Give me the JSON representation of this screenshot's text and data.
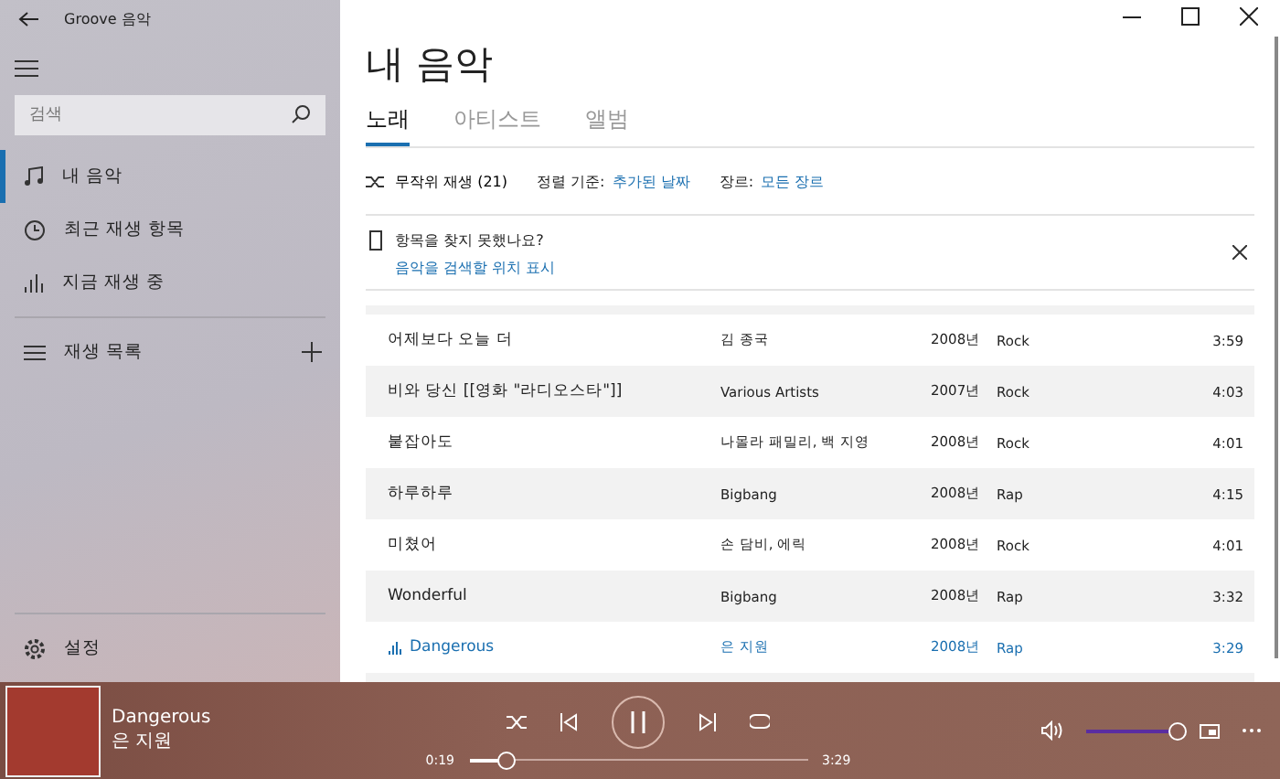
{
  "window": {
    "title": "Groove 음악"
  },
  "sidebar": {
    "search": {
      "placeholder": "검색"
    },
    "items": [
      {
        "label": "내 음악",
        "kind": "note",
        "selected": true
      },
      {
        "label": "최근 재생 항목",
        "kind": "clock",
        "selected": false
      },
      {
        "label": "지금 재생 중",
        "kind": "bars",
        "selected": false
      }
    ],
    "playlists": {
      "label": "재생 목록"
    },
    "settings": {
      "label": "설정"
    }
  },
  "main": {
    "title": "내 음악",
    "tabs": [
      {
        "label": "노래",
        "selected": true
      },
      {
        "label": "아티스트",
        "selected": false
      },
      {
        "label": "앨범",
        "selected": false
      }
    ],
    "toolbar": {
      "shuffle": "무작위 재생 (21)",
      "sort_label": "정렬 기준:",
      "sort_value": "추가된 날짜",
      "genre_label": "장르:",
      "genre_value": "모든 장르"
    },
    "notice": {
      "title": "항목을 찾지 못했나요?",
      "link": "음악을 검색할 위치 표시"
    },
    "songs": [
      {
        "title": "어제보다 오늘 더",
        "artist": "김 종국",
        "year": "2008년",
        "genre": "Rock",
        "time": "3:59",
        "playing": false
      },
      {
        "title": "비와 당신 [[영화 \"라디오스타\"]]",
        "artist": "Various Artists",
        "year": "2007년",
        "genre": "Rock",
        "time": "4:03",
        "playing": false
      },
      {
        "title": "붙잡아도",
        "artist": "나몰라 패밀리, 백 지영",
        "year": "2008년",
        "genre": "Rock",
        "time": "4:01",
        "playing": false
      },
      {
        "title": "하루하루",
        "artist": "Bigbang",
        "year": "2008년",
        "genre": "Rap",
        "time": "4:15",
        "playing": false
      },
      {
        "title": "미쳤어",
        "artist": "손 담비, 에릭",
        "year": "2008년",
        "genre": "Rock",
        "time": "4:01",
        "playing": false
      },
      {
        "title": "Wonderful",
        "artist": "Bigbang",
        "year": "2008년",
        "genre": "Rap",
        "time": "3:32",
        "playing": false
      },
      {
        "title": "Dangerous",
        "artist": "은 지원",
        "year": "2008년",
        "genre": "Rap",
        "time": "3:29",
        "playing": true
      }
    ]
  },
  "player": {
    "title": "Dangerous",
    "artist": "은 지원",
    "elapsed": "0:19",
    "total": "3:29",
    "progress": {
      "level": 0.11
    },
    "volume": {
      "level": 1
    }
  }
}
